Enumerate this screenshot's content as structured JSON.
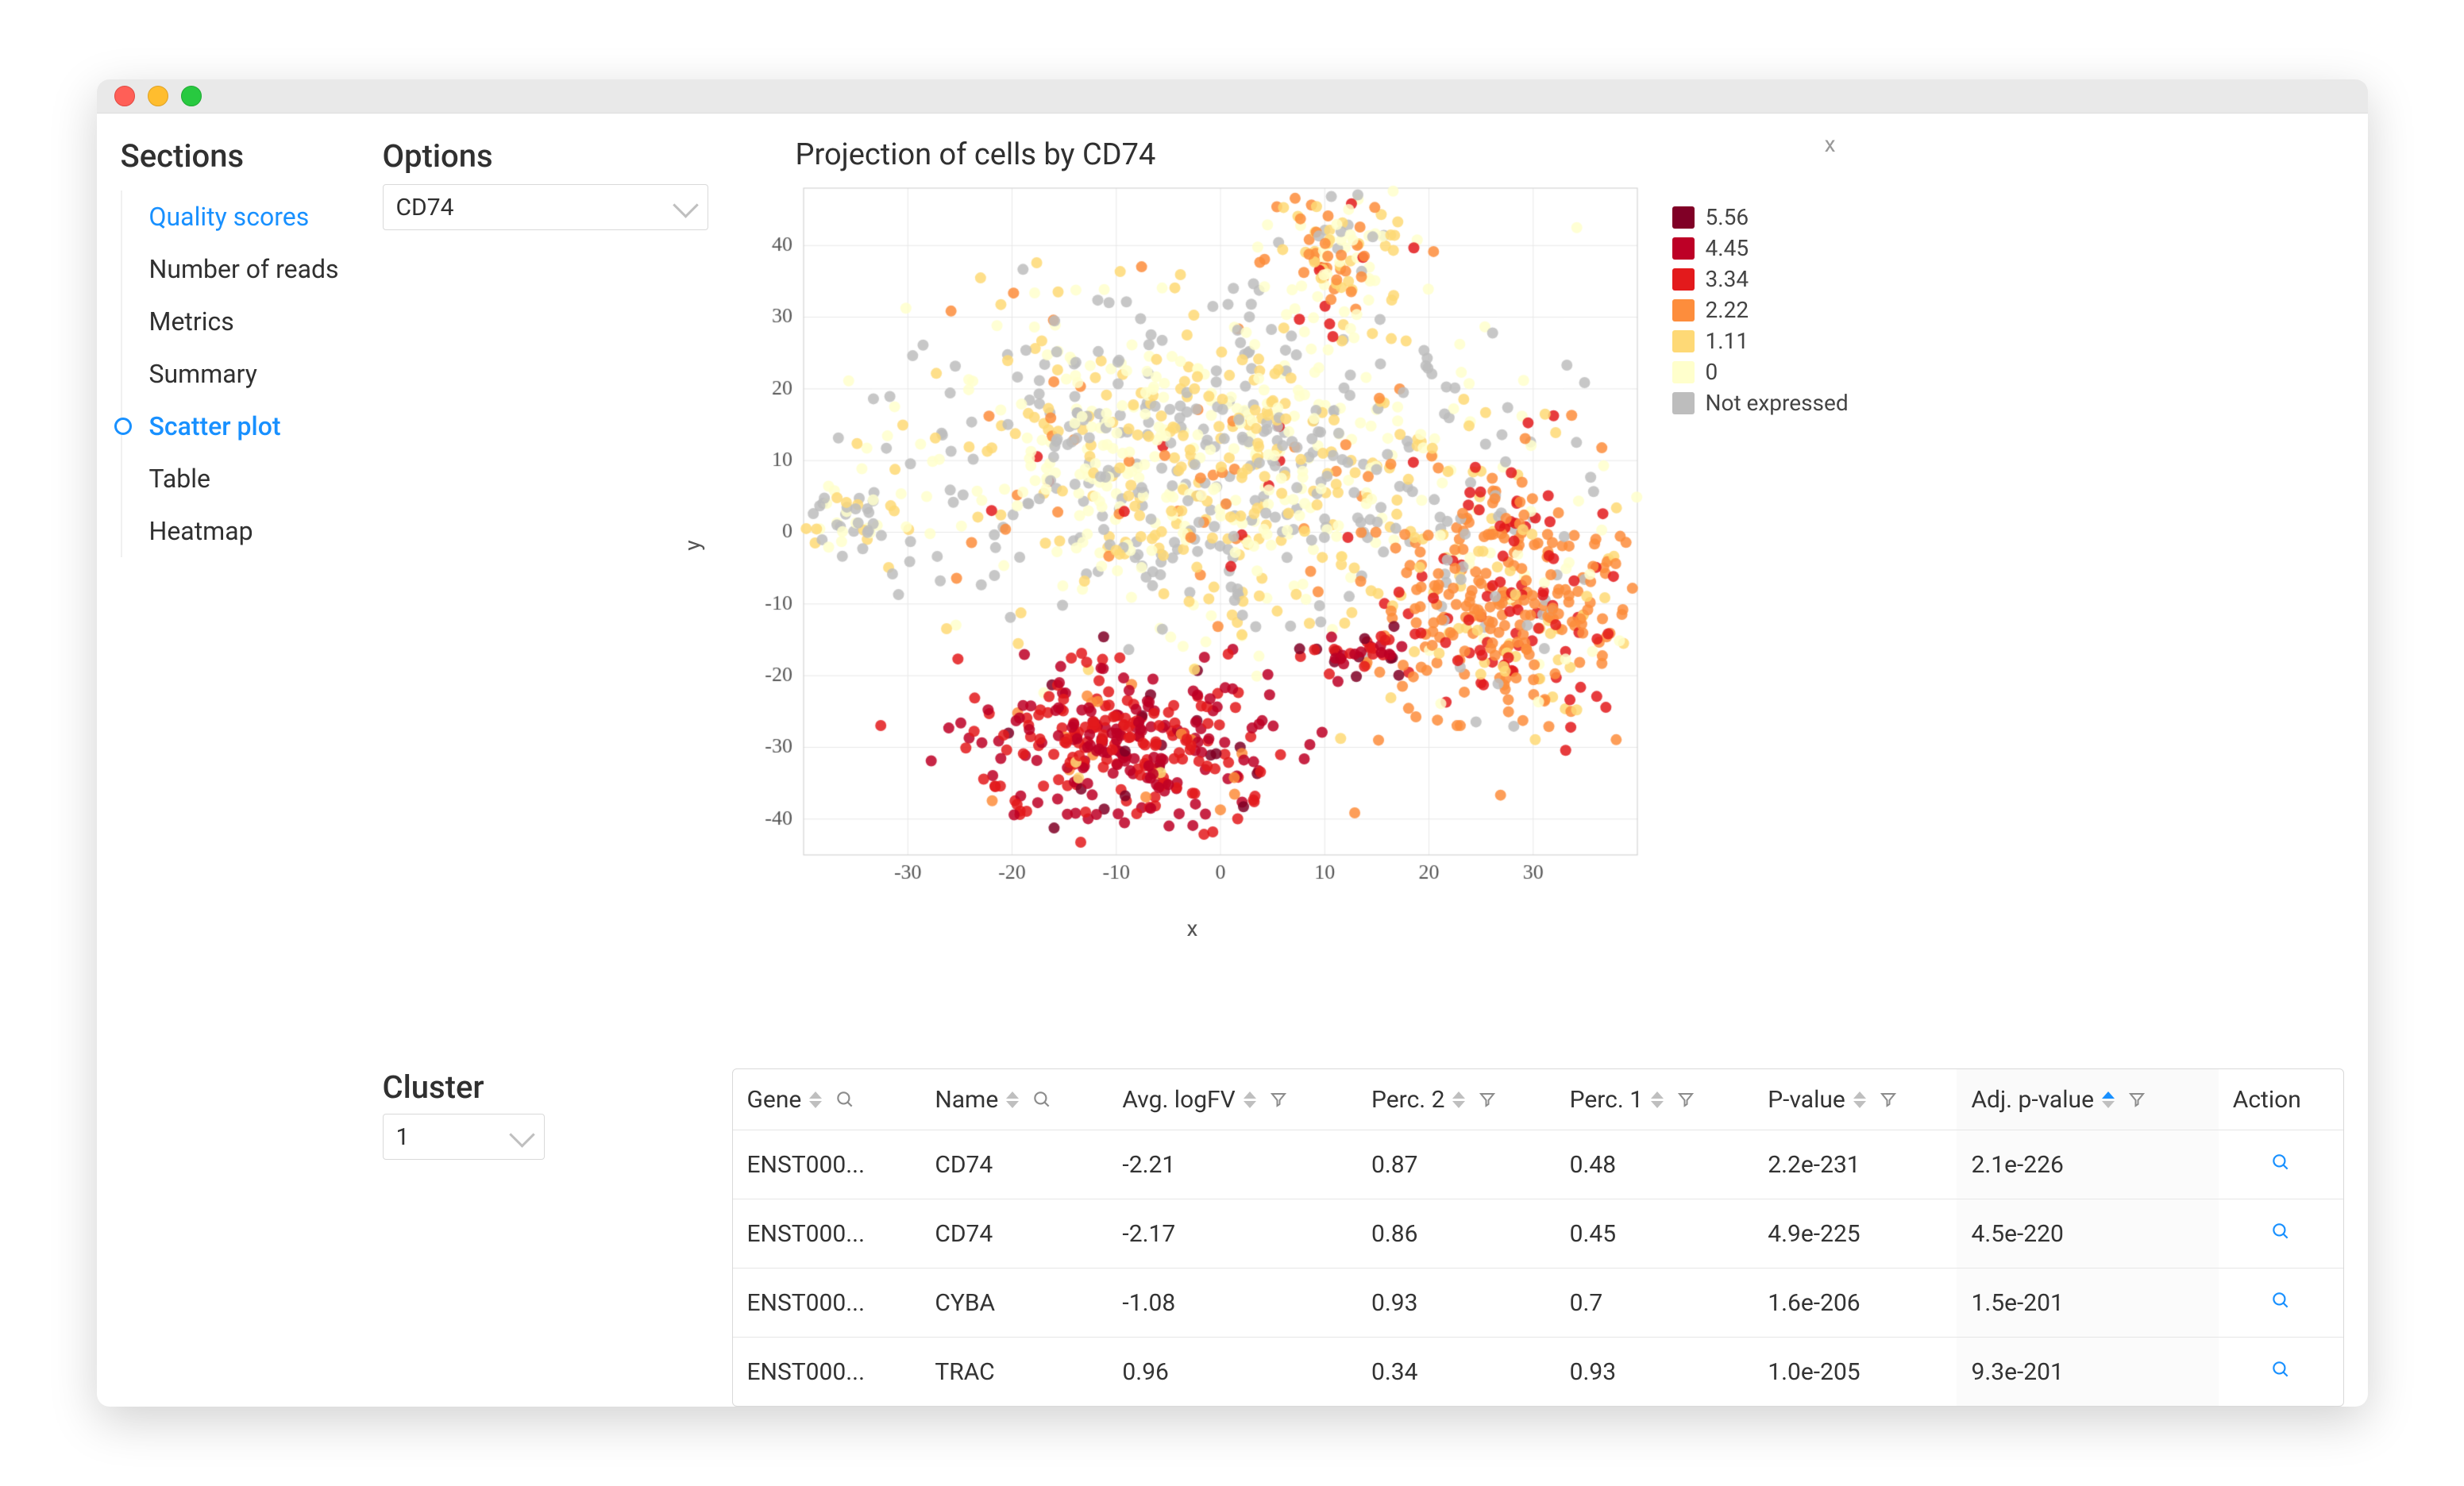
{
  "titlebar": {
    "dots": [
      "red",
      "yellow",
      "green"
    ]
  },
  "sidebar": {
    "title": "Sections",
    "items": [
      {
        "label": "Quality scores",
        "status": "link"
      },
      {
        "label": "Number of reads",
        "status": "normal"
      },
      {
        "label": "Metrics",
        "status": "normal"
      },
      {
        "label": "Summary",
        "status": "normal"
      },
      {
        "label": "Scatter plot",
        "status": "active"
      },
      {
        "label": "Table",
        "status": "normal"
      },
      {
        "label": "Heatmap",
        "status": "normal"
      }
    ]
  },
  "options": {
    "title": "Options",
    "gene_select": {
      "value": "CD74"
    }
  },
  "close_x": "x",
  "cluster": {
    "title": "Cluster",
    "select": {
      "value": "1"
    }
  },
  "table": {
    "columns": [
      {
        "label": "Gene",
        "sortable": true,
        "filter": "search"
      },
      {
        "label": "Name",
        "sortable": true,
        "filter": "search"
      },
      {
        "label": "Avg. logFV",
        "sortable": true,
        "filter": "funnel"
      },
      {
        "label": "Perc. 2",
        "sortable": true,
        "filter": "funnel"
      },
      {
        "label": "Perc. 1",
        "sortable": true,
        "filter": "funnel"
      },
      {
        "label": "P-value",
        "sortable": true,
        "filter": "funnel"
      },
      {
        "label": "Adj. p-value",
        "sortable": true,
        "filter": "funnel",
        "sorted": "asc"
      },
      {
        "label": "Action",
        "sortable": false
      }
    ],
    "rows": [
      {
        "gene": "ENST000...",
        "name": "CD74",
        "logfv": "-2.21",
        "p2": "0.87",
        "p1": "0.48",
        "pv": "2.2e-231",
        "apv": "2.1e-226"
      },
      {
        "gene": "ENST000...",
        "name": "CD74",
        "logfv": "-2.17",
        "p2": "0.86",
        "p1": "0.45",
        "pv": "4.9e-225",
        "apv": "4.5e-220"
      },
      {
        "gene": "ENST000...",
        "name": "CYBA",
        "logfv": "-1.08",
        "p2": "0.93",
        "p1": "0.7",
        "pv": "1.6e-206",
        "apv": "1.5e-201"
      },
      {
        "gene": "ENST000...",
        "name": "TRAC",
        "logfv": "0.96",
        "p2": "0.34",
        "p1": "0.93",
        "pv": "1.0e-205",
        "apv": "9.3e-201"
      }
    ]
  },
  "chart_data": {
    "type": "scatter",
    "title": "Projection of cells by CD74",
    "xlabel": "x",
    "ylabel": "y",
    "xlim": [
      -40,
      40
    ],
    "ylim": [
      -45,
      48
    ],
    "xticks": [
      -30,
      -20,
      -10,
      0,
      10,
      20,
      30
    ],
    "yticks": [
      -40,
      -30,
      -20,
      -10,
      0,
      10,
      20,
      30,
      40
    ],
    "grid": true,
    "color_scale": {
      "levels": [
        {
          "v": 5.56,
          "hex": "#800026"
        },
        {
          "v": 4.45,
          "hex": "#bd0026"
        },
        {
          "v": 3.34,
          "hex": "#e31a1c"
        },
        {
          "v": 2.22,
          "hex": "#fd8d3c"
        },
        {
          "v": 1.11,
          "hex": "#fed976"
        },
        {
          "v": 0,
          "hex": "#ffffcc"
        }
      ],
      "not_expressed": {
        "label": "Not expressed",
        "hex": "#bdbdbd"
      }
    },
    "legend": [
      "5.56",
      "4.45",
      "3.34",
      "2.22",
      "1.11",
      "0",
      "Not expressed"
    ],
    "clusters": [
      {
        "region": "main-diffuse",
        "cx": -2,
        "cy": 10,
        "rx": 28,
        "ry": 22,
        "n": 900,
        "mix": {
          "0": 0.35,
          "1": 0.25,
          "2": 0.05,
          "3": 0.01,
          "ne": 0.34
        }
      },
      {
        "region": "upper-spur",
        "cx": 11,
        "cy": 38,
        "rx": 7,
        "ry": 10,
        "n": 120,
        "mix": {
          "0": 0.25,
          "1": 0.3,
          "2": 0.3,
          "3": 0.1,
          "ne": 0.05
        }
      },
      {
        "region": "right-island",
        "cx": 27,
        "cy": -10,
        "rx": 12,
        "ry": 18,
        "n": 420,
        "mix": {
          "0": 0.05,
          "1": 0.15,
          "2": 0.5,
          "3": 0.25,
          "ne": 0.05
        }
      },
      {
        "region": "bottom-red",
        "cx": -9,
        "cy": -30,
        "rx": 14,
        "ry": 10,
        "n": 360,
        "mix": {
          "0": 0.0,
          "1": 0.02,
          "2": 0.05,
          "3": 0.45,
          "4": 0.4,
          "5": 0.08
        }
      },
      {
        "region": "bridge",
        "cx": 13,
        "cy": -17,
        "rx": 5,
        "ry": 3,
        "n": 40,
        "mix": {
          "3": 0.4,
          "4": 0.4,
          "5": 0.2
        }
      },
      {
        "region": "left-tail",
        "cx": -35,
        "cy": 2,
        "rx": 5,
        "ry": 6,
        "n": 50,
        "mix": {
          "0": 0.3,
          "1": 0.2,
          "ne": 0.5
        }
      }
    ],
    "point_radius": 5
  }
}
